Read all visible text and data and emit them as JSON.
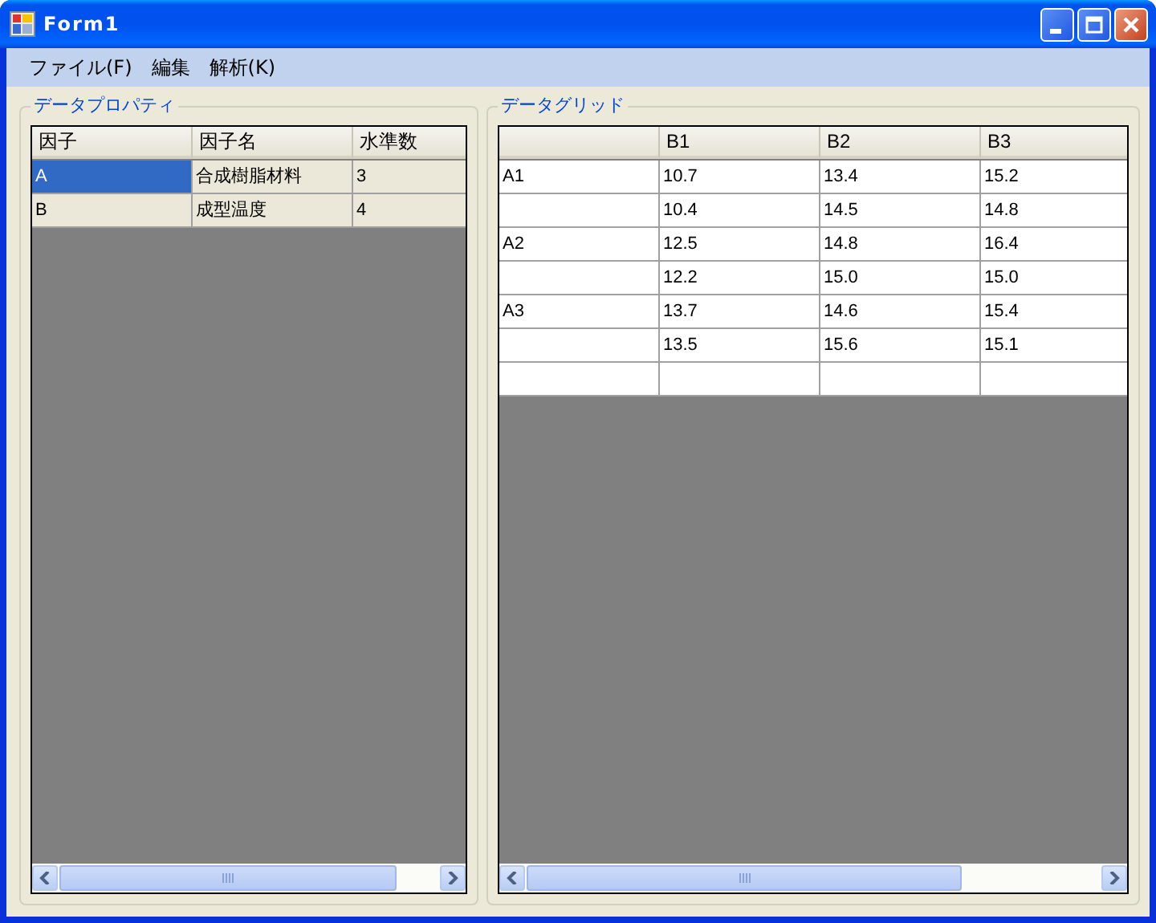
{
  "window": {
    "title": "Form1"
  },
  "menu": [
    "ファイル(F)",
    "編集",
    "解析(K)"
  ],
  "panels": [
    {
      "title": "データプロパティ",
      "grid": {
        "row_headers": false,
        "new_row": false,
        "columns": [
          "因子",
          "因子名",
          "水準数"
        ],
        "rows": [
          {
            "cells": [
              {
                "text": "A",
                "selected": true
              },
              {
                "text": "合成樹脂材料",
                "selected": false
              },
              {
                "text": "3",
                "selected": false
              }
            ]
          },
          {
            "cells": [
              {
                "text": "B",
                "selected": false
              },
              {
                "text": "成型温度",
                "selected": false
              },
              {
                "text": "4",
                "selected": false
              }
            ]
          }
        ]
      }
    },
    {
      "title": "データグリッド",
      "grid": {
        "row_headers": true,
        "new_row": true,
        "columns": [
          "B1",
          "B2",
          "B3"
        ],
        "rows": [
          {
            "label": "A1",
            "cells": [
              "10.7",
              "13.4",
              "15.2"
            ]
          },
          {
            "cells": [
              "10.4",
              "14.5",
              "14.8"
            ]
          },
          {
            "label": "A2",
            "cells": [
              "12.5",
              "14.8",
              "16.4"
            ]
          },
          {
            "cells": [
              "12.2",
              "15.0",
              "15.0"
            ]
          },
          {
            "label": "A3",
            "cells": [
              "13.7",
              "14.6",
              "15.4"
            ]
          },
          {
            "cells": [
              "13.5",
              "15.6",
              "15.1"
            ]
          }
        ]
      }
    }
  ]
}
